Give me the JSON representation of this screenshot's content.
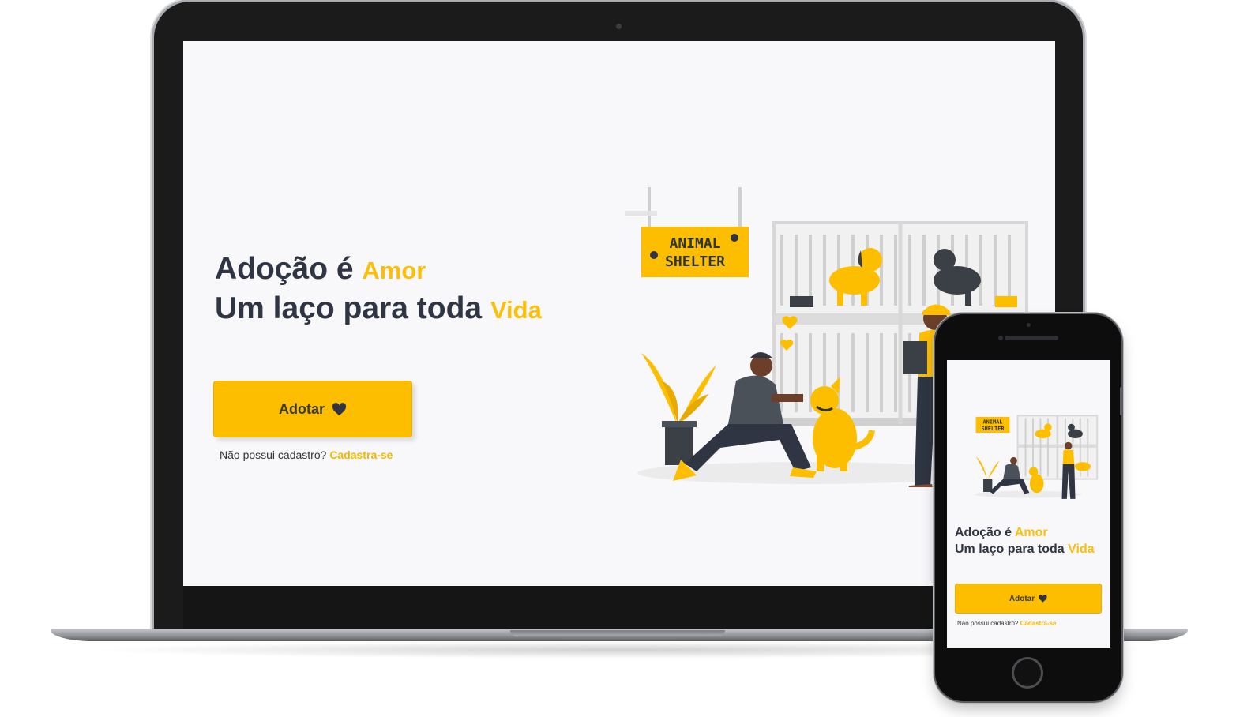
{
  "laptop": {
    "hero": {
      "line1_prefix": "Adoção é",
      "line1_accent": "Amor",
      "line2_prefix": "Um laço para toda",
      "line2_accent": "Vida"
    },
    "adopt_button": {
      "label": "Adotar",
      "icon": "heart-icon"
    },
    "signup": {
      "question": "Não possui cadastro?",
      "link": "Cadastra-se"
    },
    "illustration": {
      "sign_line1": "ANIMAL",
      "sign_line2": "SHELTER"
    }
  },
  "phone": {
    "hero": {
      "line1_prefix": "Adoção é",
      "line1_accent": "Amor",
      "line2_prefix": "Um laço para toda",
      "line2_accent": "Vida"
    },
    "adopt_button": {
      "label": "Adotar",
      "icon": "heart-icon"
    },
    "signup": {
      "question": "Não possui cadastro?",
      "link": "Cadastra-se"
    },
    "illustration": {
      "sign_line1": "ANIMAL",
      "sign_line2": "SHELTER"
    }
  },
  "colors": {
    "accent": "#fdbe00",
    "text_dark": "#2f3542",
    "background": "#f8f8fb",
    "illustration_dark": "#3b4046"
  }
}
